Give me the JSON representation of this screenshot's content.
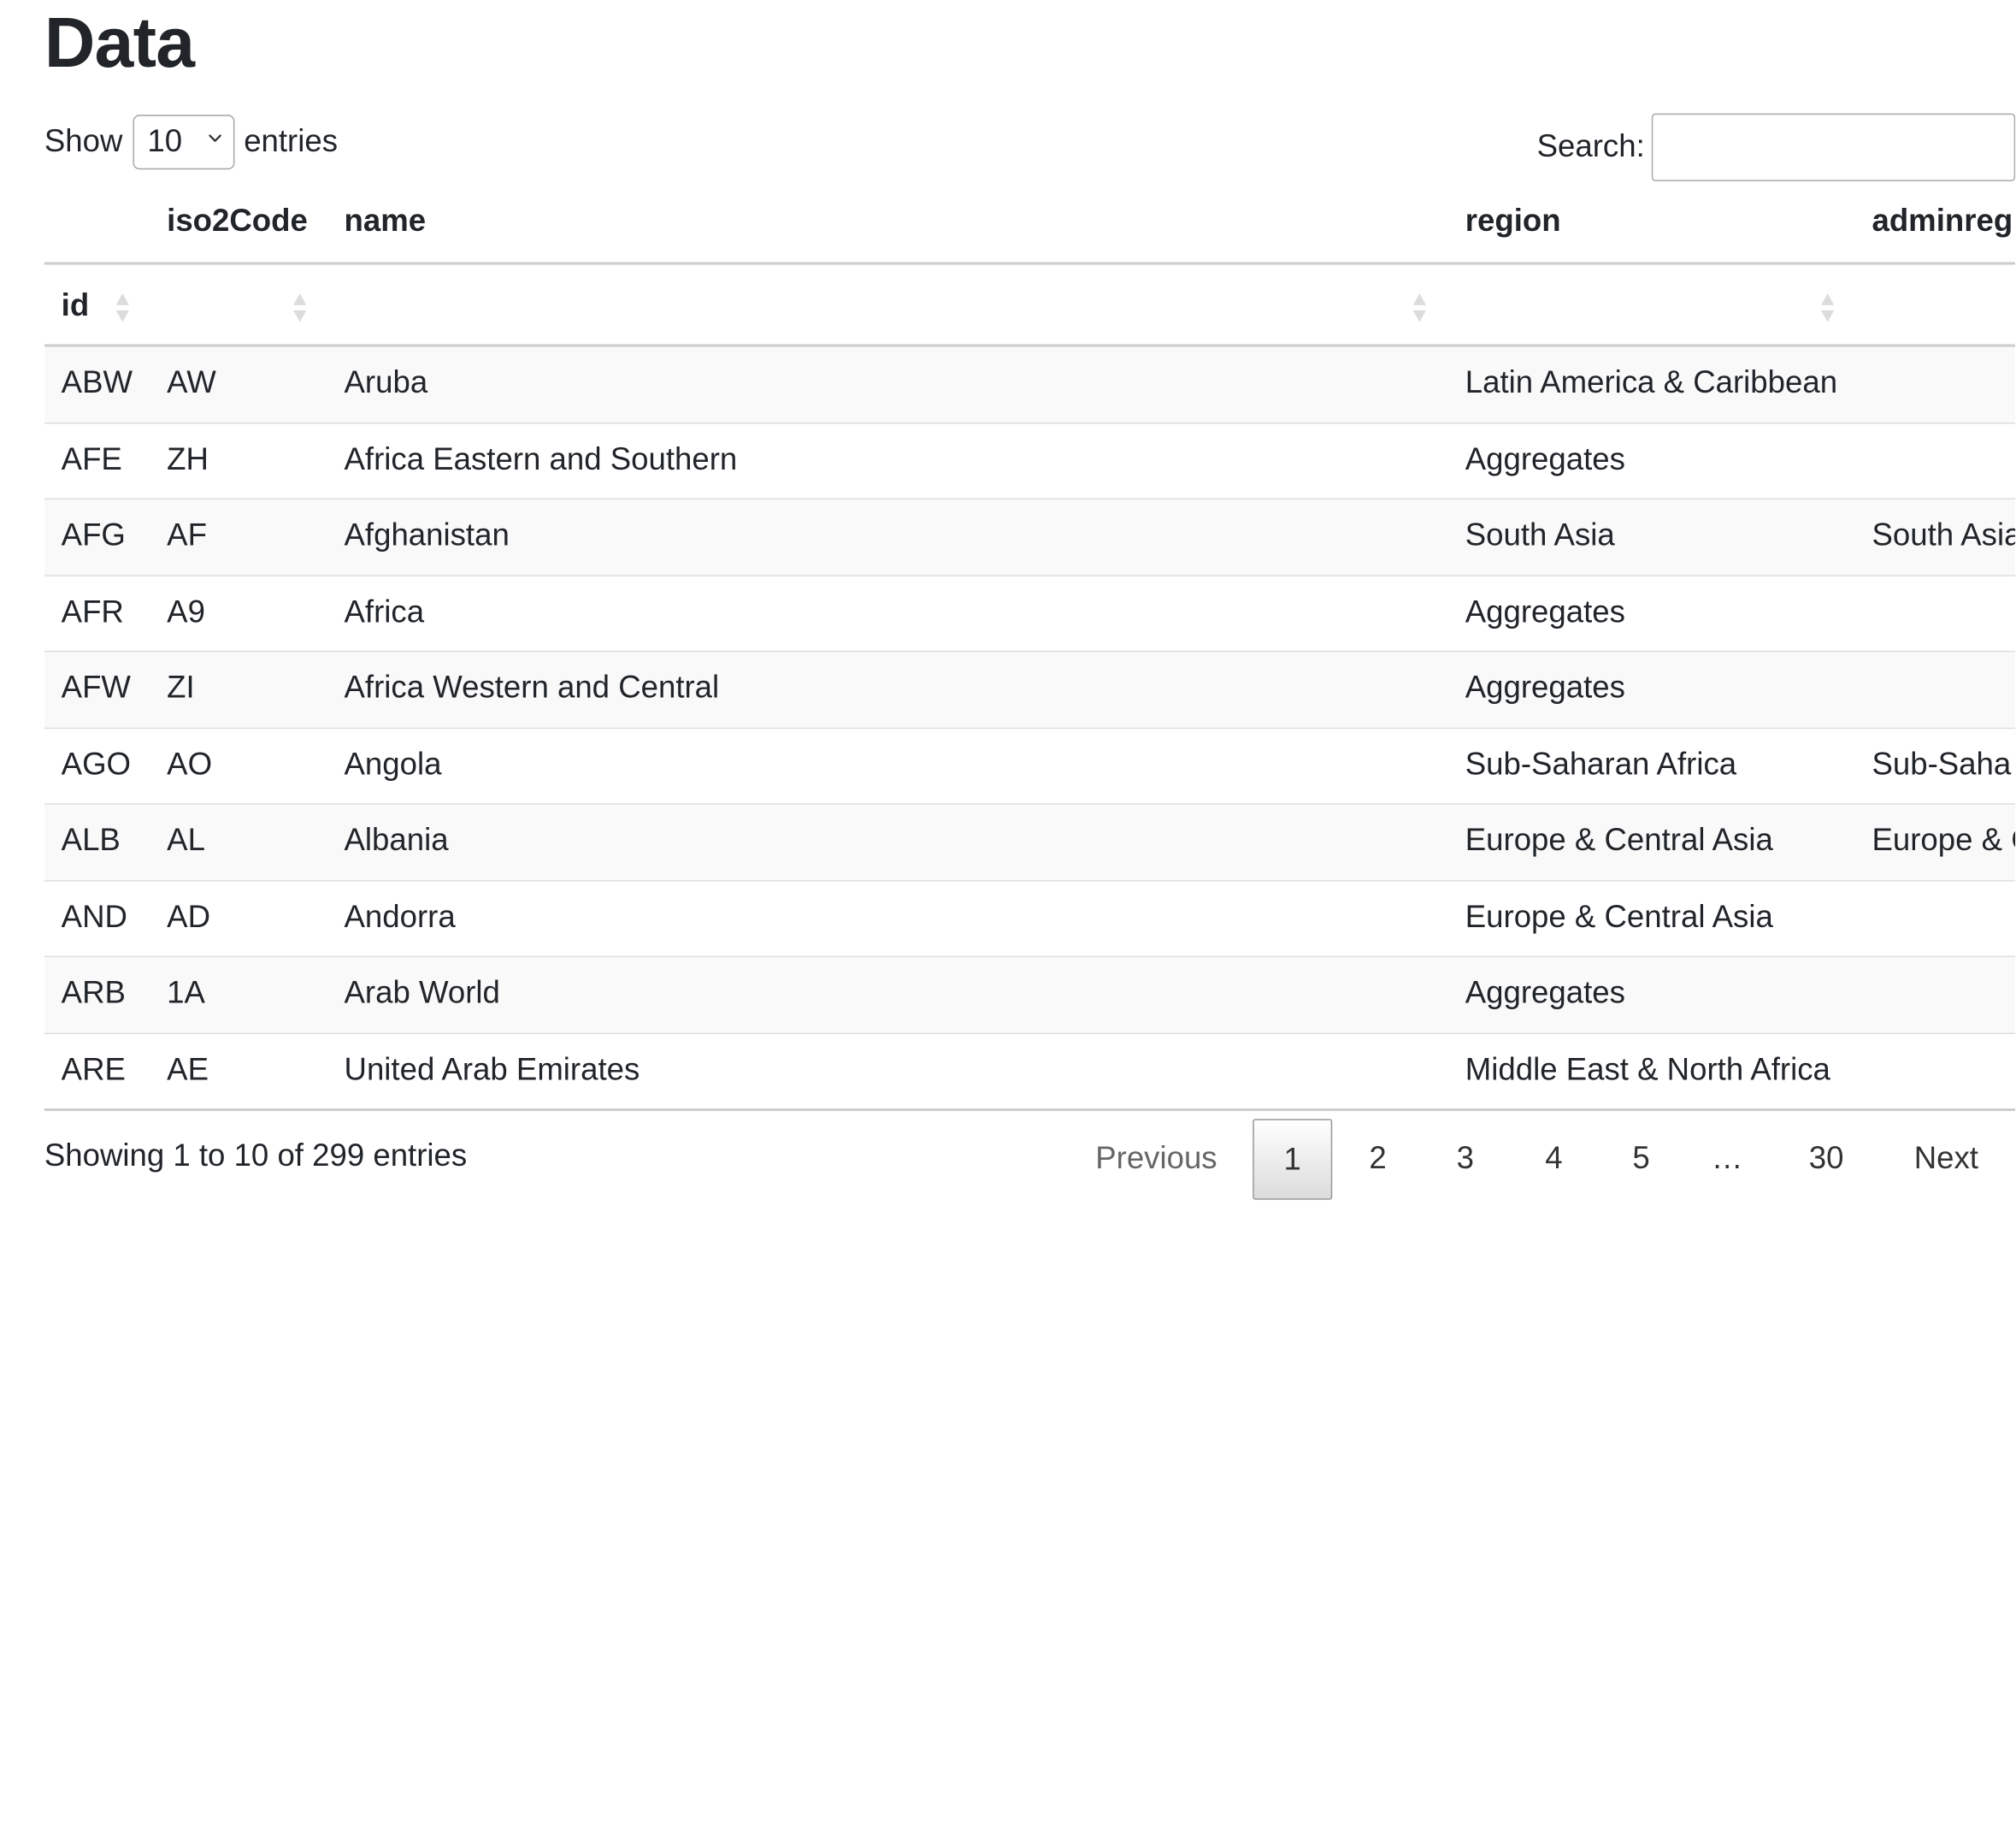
{
  "page_title": "Data",
  "length_menu": {
    "show_label": "Show",
    "selected": "10",
    "entries_label": "entries"
  },
  "search": {
    "label": "Search:",
    "value": "",
    "placeholder": ""
  },
  "table": {
    "header_top": [
      "",
      "iso2Code",
      "name",
      "region",
      "adminreg"
    ],
    "header_sort": [
      "id",
      "",
      "",
      "",
      ""
    ],
    "rows": [
      {
        "id": "ABW",
        "iso2Code": "AW",
        "name": "Aruba",
        "region": "Latin America & Caribbean",
        "adminregion": ""
      },
      {
        "id": "AFE",
        "iso2Code": "ZH",
        "name": "Africa Eastern and Southern",
        "region": "Aggregates",
        "adminregion": ""
      },
      {
        "id": "AFG",
        "iso2Code": "AF",
        "name": "Afghanistan",
        "region": "South Asia",
        "adminregion": "South Asia"
      },
      {
        "id": "AFR",
        "iso2Code": "A9",
        "name": "Africa",
        "region": "Aggregates",
        "adminregion": ""
      },
      {
        "id": "AFW",
        "iso2Code": "ZI",
        "name": "Africa Western and Central",
        "region": "Aggregates",
        "adminregion": ""
      },
      {
        "id": "AGO",
        "iso2Code": "AO",
        "name": "Angola",
        "region": "Sub-Saharan Africa",
        "adminregion": "Sub-Saha"
      },
      {
        "id": "ALB",
        "iso2Code": "AL",
        "name": "Albania",
        "region": "Europe & Central Asia",
        "adminregion": "Europe & C"
      },
      {
        "id": "AND",
        "iso2Code": "AD",
        "name": "Andorra",
        "region": "Europe & Central Asia",
        "adminregion": ""
      },
      {
        "id": "ARB",
        "iso2Code": "1A",
        "name": "Arab World",
        "region": "Aggregates",
        "adminregion": ""
      },
      {
        "id": "ARE",
        "iso2Code": "AE",
        "name": "United Arab Emirates",
        "region": "Middle East & North Africa",
        "adminregion": ""
      }
    ]
  },
  "info_text": "Showing 1 to 10 of 299 entries",
  "pagination": {
    "previous": "Previous",
    "pages": [
      "1",
      "2",
      "3",
      "4",
      "5"
    ],
    "ellipsis": "…",
    "last_page": "30",
    "next": "Next",
    "current": "1"
  },
  "icons": {
    "sort": "sort-both-icon",
    "dropdown": "chevron-down-icon"
  },
  "colors": {
    "text": "#212529",
    "border": "#cccccc",
    "stripe": "#f9f9f9",
    "sort_icon": "#dcdcdc"
  }
}
